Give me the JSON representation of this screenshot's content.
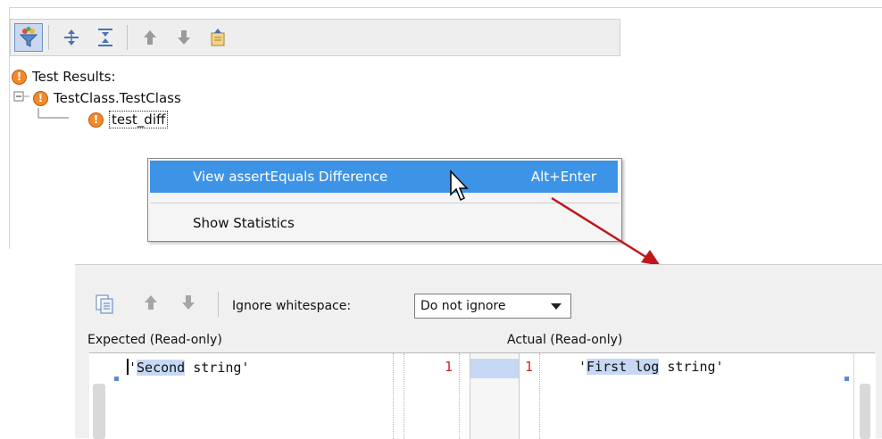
{
  "top_toolbar": {
    "icons": [
      "filter-icon",
      "expand-all-icon",
      "collapse-all-icon",
      "up-arrow-icon",
      "down-arrow-icon",
      "export-icon"
    ]
  },
  "tree": {
    "root_label": "Test Results:",
    "class_label": "TestClass.TestClass",
    "test_label": "test_diff",
    "status_icon": "!"
  },
  "context_menu": {
    "items": [
      {
        "label": "View assertEquals Difference",
        "shortcut": "Alt+Enter"
      },
      {
        "label": "Show Statistics",
        "shortcut": ""
      }
    ]
  },
  "diff_panel": {
    "ignore_label": "Ignore whitespace:",
    "ignore_value": "Do not ignore",
    "expected_label": "Expected (Read-only)",
    "actual_label": "Actual (Read-only)",
    "left_line_number": "1",
    "right_line_number": "1",
    "left_prefix": "'",
    "left_highlight": "Second",
    "left_rest": " string'",
    "right_prefix": "'",
    "right_highlight": "First log",
    "right_rest": " string'"
  },
  "colors": {
    "menu_highlight": "#3d94e6",
    "warning": "#f08a2a",
    "diff_highlight": "#c7d8f4",
    "line_number": "#c0262c",
    "annotation_arrow": "#c0171b"
  }
}
